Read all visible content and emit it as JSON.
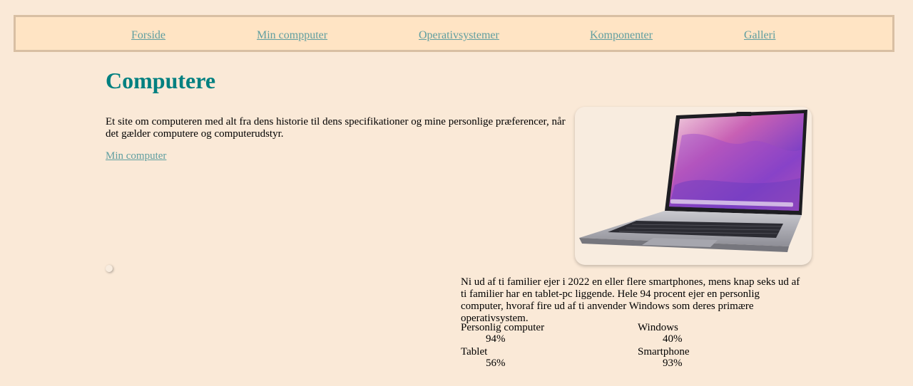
{
  "nav": {
    "items": [
      {
        "label": "Forside"
      },
      {
        "label": "Min compputer"
      },
      {
        "label": "Operativsystemer"
      },
      {
        "label": "Komponenter"
      },
      {
        "label": "Galleri"
      }
    ]
  },
  "main": {
    "title": "Computere",
    "intro": "Et site om computeren med alt fra dens historie til dens specifikationer og mine personlige præferencer, når det gælder computere og computerudstyr.",
    "link_label": "Min computer",
    "image_icon": "laptop-photo"
  },
  "stats": {
    "text": "Ni ud af ti familier ejer i 2022 en eller flere smartphones, mens knap seks ud af ti familier har en tablet-pc liggende. Hele 94 procent ejer en personlig computer, hvoraf fire ud af ti anvender Windows som deres primære operativsystem.",
    "items": [
      {
        "label": "Personlig computer",
        "value": "94%"
      },
      {
        "label": "Windows",
        "value": "40%"
      },
      {
        "label": "Tablet",
        "value": "56%"
      },
      {
        "label": "Smartphone",
        "value": "93%"
      }
    ]
  },
  "colors": {
    "background": "#fae9d7",
    "nav_background": "#ffe4c4",
    "nav_border": "#d8bfa3",
    "link": "#5f9ea0",
    "title": "#008080"
  }
}
